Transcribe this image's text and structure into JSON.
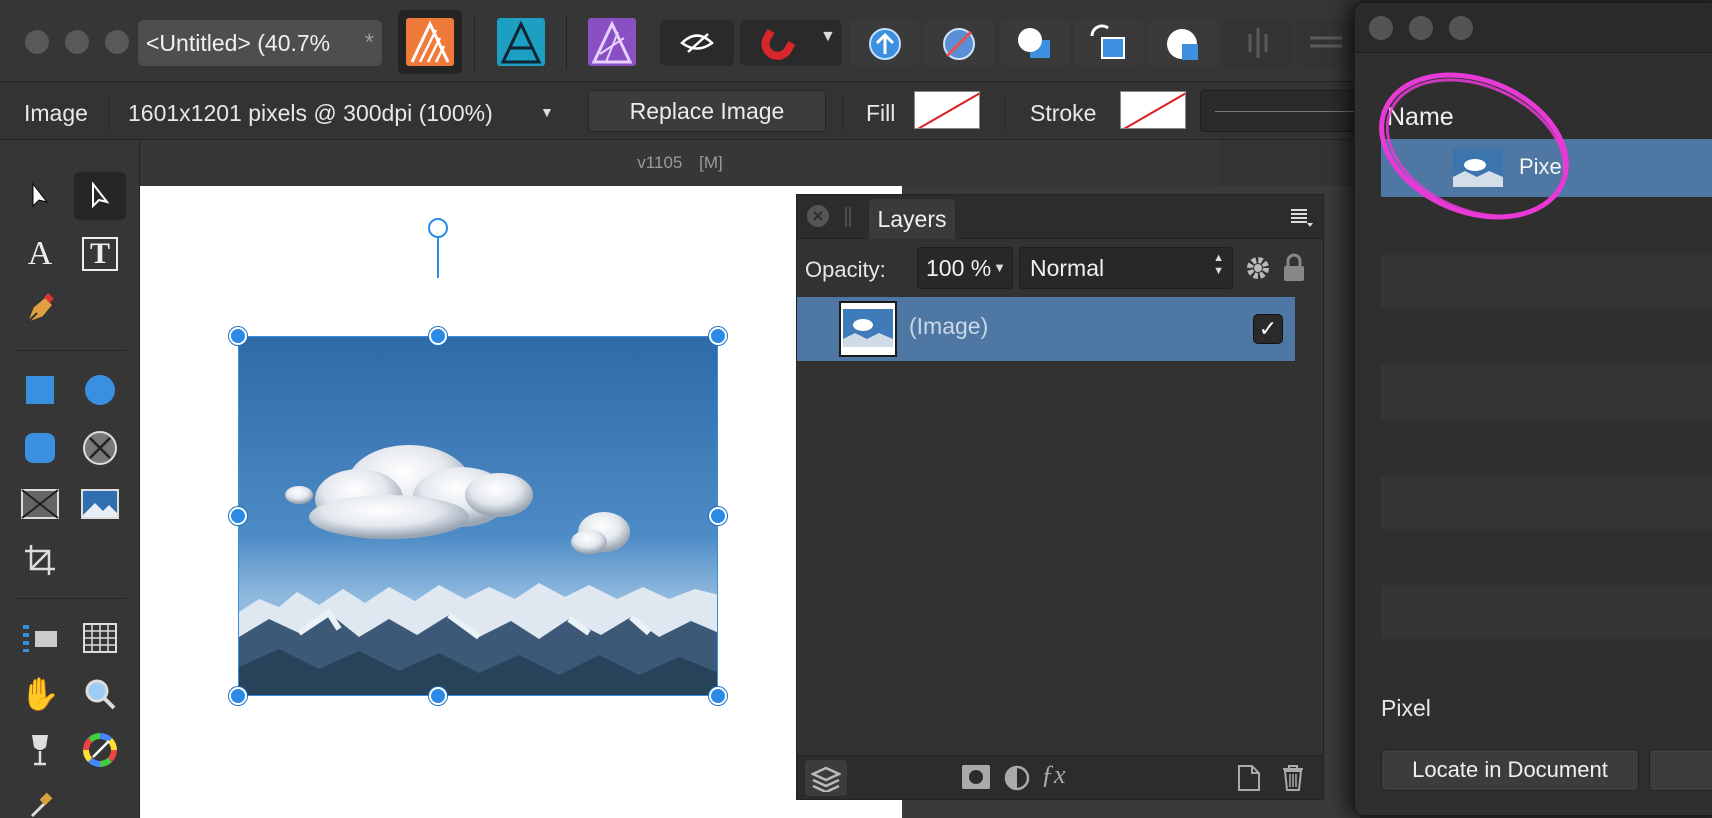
{
  "window": {
    "title": "<Untitled> (40.7%"
  },
  "toolbar": {
    "doc_tab_close": "*",
    "personas": [
      {
        "icon": "publisher-icon",
        "color": "#f07a3a"
      },
      {
        "icon": "designer-icon",
        "color": "#1c9fc0"
      },
      {
        "icon": "photo-icon",
        "color": "#8a4fc2"
      }
    ]
  },
  "context": {
    "label": "Image",
    "info": "1601x1201 pixels @ 300dpi (100%)",
    "replace_label": "Replace Image",
    "fill_label": "Fill",
    "stroke_label": "Stroke"
  },
  "canvas": {
    "status_version": "v1105",
    "status_mode": "[M]"
  },
  "layers": {
    "tab": "Layers",
    "opacity_label": "Opacity:",
    "opacity_value": "100 %",
    "blend_mode": "Normal",
    "rows": [
      {
        "name": "(Image)",
        "visible": "✓"
      }
    ]
  },
  "resources": {
    "column_header": "Name",
    "items": [
      {
        "name": "Pixel"
      }
    ],
    "selected_label": "Pixel",
    "locate_button": "Locate in Document"
  },
  "colors": {
    "accent": "#4f77a3",
    "handle": "#2b8ae6",
    "annotation": "#e83ad6"
  }
}
